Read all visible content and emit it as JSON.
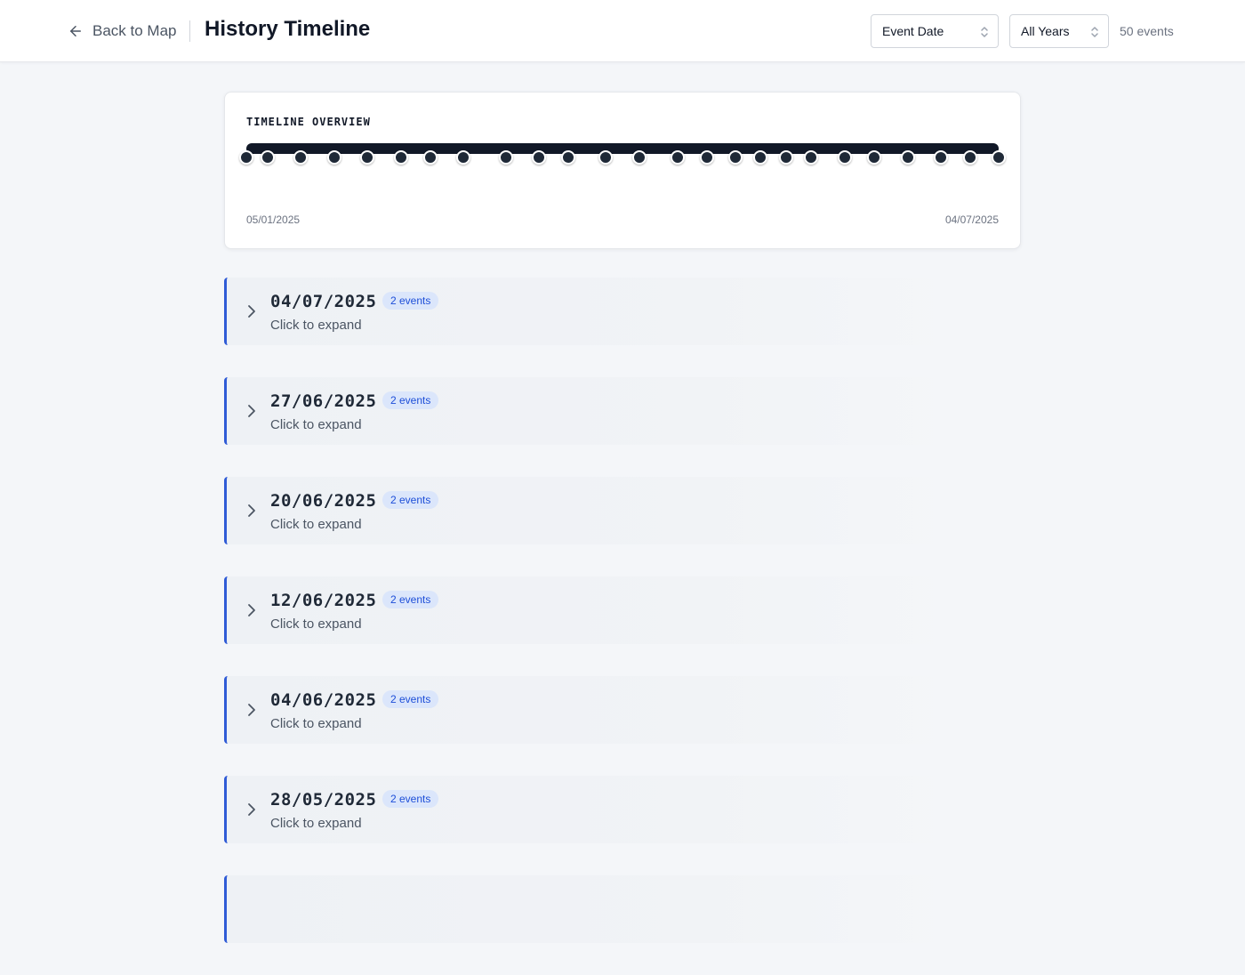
{
  "header": {
    "back_label": "Back to Map",
    "title": "History Timeline",
    "sort_select": "Event Date",
    "year_select": "All Years",
    "event_count": "50 events"
  },
  "overview": {
    "title": "TIMELINE OVERVIEW",
    "start_date": "05/01/2025",
    "end_date": "04/07/2025",
    "marker_positions": [
      0,
      0.028,
      0.072,
      0.117,
      0.161,
      0.206,
      0.245,
      0.289,
      0.345,
      0.389,
      0.428,
      0.478,
      0.523,
      0.573,
      0.612,
      0.65,
      0.683,
      0.717,
      0.751,
      0.795,
      0.834,
      0.879,
      0.923,
      0.962,
      1
    ]
  },
  "groups": [
    {
      "date": "04/07/2025",
      "badge": "2 events",
      "hint": "Click to expand"
    },
    {
      "date": "27/06/2025",
      "badge": "2 events",
      "hint": "Click to expand"
    },
    {
      "date": "20/06/2025",
      "badge": "2 events",
      "hint": "Click to expand"
    },
    {
      "date": "12/06/2025",
      "badge": "2 events",
      "hint": "Click to expand"
    },
    {
      "date": "04/06/2025",
      "badge": "2 events",
      "hint": "Click to expand"
    },
    {
      "date": "28/05/2025",
      "badge": "2 events",
      "hint": "Click to expand"
    },
    {
      "date": "",
      "badge": "",
      "hint": ""
    }
  ],
  "colors": {
    "accent": "#2f5bd6",
    "badge_bg": "#dbe6fb",
    "track": "#111827"
  }
}
